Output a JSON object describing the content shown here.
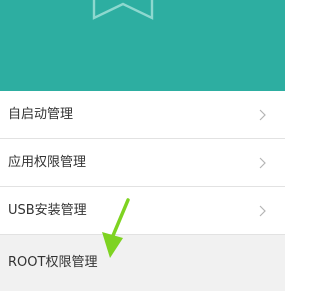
{
  "header": {
    "background_color": "#2daea1",
    "icon": "bookmark-icon"
  },
  "menu": {
    "items": [
      {
        "label": "自启动管理",
        "icon": "chevron-right-icon"
      },
      {
        "label": "应用权限管理",
        "icon": "chevron-right-icon"
      },
      {
        "label": "USB安装管理",
        "icon": "chevron-right-icon"
      },
      {
        "label": "ROOT权限管理"
      }
    ]
  },
  "annotation": {
    "icon": "green-arrow-icon",
    "color": "#7ed321"
  }
}
